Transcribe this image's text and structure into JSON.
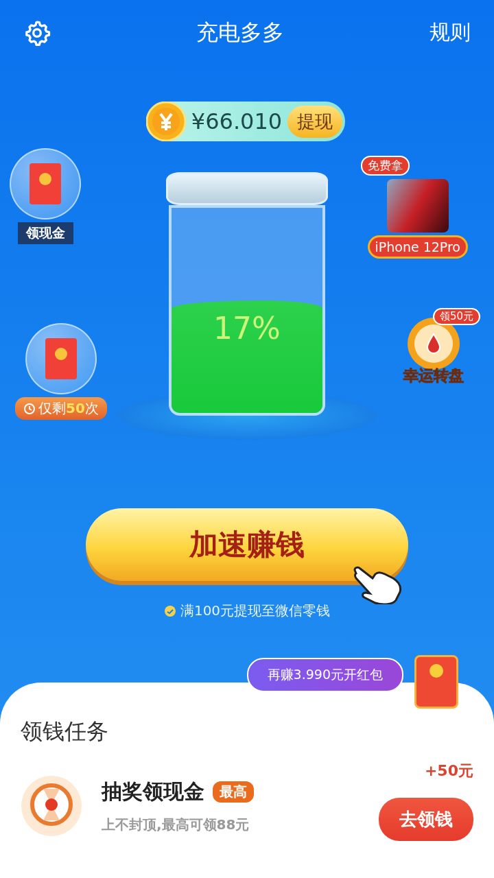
{
  "header": {
    "title": "充电多多",
    "rules_link": "规则"
  },
  "balance": {
    "amount": "¥66.010",
    "withdraw_button": "提现"
  },
  "left_widgets": [
    {
      "label": "领现金",
      "kind": "cash"
    },
    {
      "label": "仅剩**50**次",
      "kind": "count"
    }
  ],
  "right_widgets": [
    {
      "kind": "phone",
      "badge": "免费拿",
      "label": "iPhone 12Pro"
    },
    {
      "kind": "wheel",
      "badge": "领50元",
      "label": "幸运转盘"
    }
  ],
  "battery": {
    "reading": "17%",
    "level": 0.55
  },
  "boost_button": "加速赚钱",
  "wechat_note": "满100元提现至微信零钱",
  "red_packet_tip": "再赚3.990元开红包",
  "tasks": {
    "title": "领钱任务",
    "items": [
      {
        "name": "抽奖领现金",
        "tag": "最高",
        "description": "上不封顶,最高可领88元",
        "reward": "+50元",
        "button": "去领钱"
      }
    ]
  }
}
